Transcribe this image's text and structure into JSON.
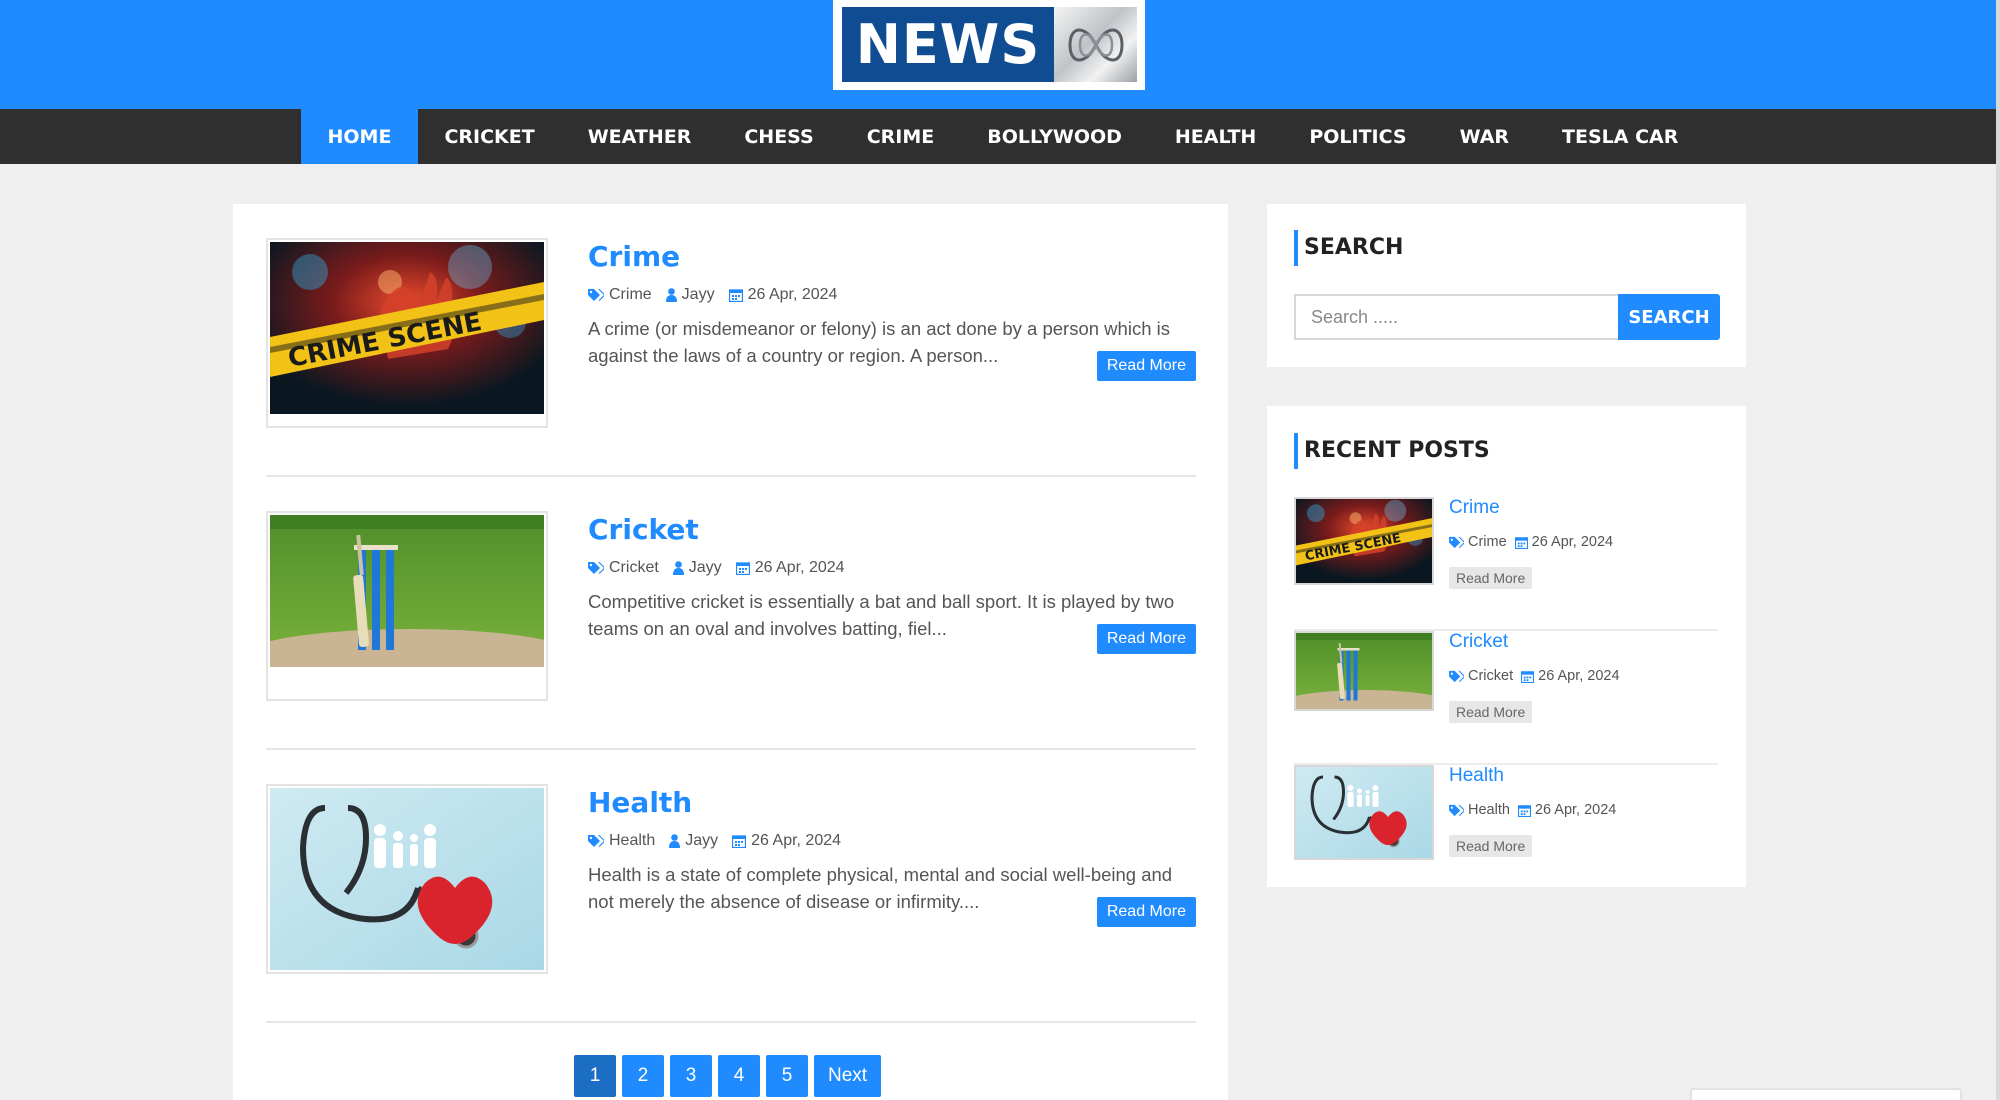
{
  "logo": {
    "text": "NEWS",
    "mark_icon": "abc-lissajous-icon"
  },
  "nav": {
    "items": [
      {
        "label": "HOME",
        "active": true
      },
      {
        "label": "CRICKET"
      },
      {
        "label": "WEATHER"
      },
      {
        "label": "CHESS"
      },
      {
        "label": "CRIME"
      },
      {
        "label": "BOLLYWOOD"
      },
      {
        "label": "HEALTH"
      },
      {
        "label": "POLITICS"
      },
      {
        "label": "WAR"
      },
      {
        "label": "TESLA CAR"
      }
    ]
  },
  "posts": [
    {
      "title": "Crime",
      "category": "Crime",
      "author": "Jayy",
      "date": "26 Apr, 2024",
      "excerpt": "A crime (or misdemeanor or felony) is an act done by a person which is against the laws of a country or region. A person...",
      "read_more": "Read More",
      "image": "crime-scene-tape-photo"
    },
    {
      "title": "Cricket",
      "category": "Cricket",
      "author": "Jayy",
      "date": "26 Apr, 2024",
      "excerpt": "Competitive cricket is essentially a bat and ball sport. It is played by two teams on an oval and involves batting, fiel...",
      "read_more": "Read More",
      "image": "cricket-wickets-photo"
    },
    {
      "title": "Health",
      "category": "Health",
      "author": "Jayy",
      "date": "26 Apr, 2024",
      "excerpt": "Health is a state of complete physical, mental and social well-being and not merely the absence of disease or infirmity....",
      "read_more": "Read More",
      "image": "stethoscope-heart-photo"
    }
  ],
  "pagination": {
    "pages": [
      "1",
      "2",
      "3",
      "4",
      "5"
    ],
    "current": "1",
    "next_label": "Next"
  },
  "sidebar": {
    "search": {
      "title": "SEARCH",
      "placeholder": "Search .....",
      "button": "SEARCH"
    },
    "recent": {
      "title": "RECENT POSTS",
      "items": [
        {
          "title": "Crime",
          "category": "Crime",
          "date": "26 Apr, 2024",
          "read_more": "Read More"
        },
        {
          "title": "Cricket",
          "category": "Cricket",
          "date": "26 Apr, 2024",
          "read_more": "Read More"
        },
        {
          "title": "Health",
          "category": "Health",
          "date": "26 Apr, 2024",
          "read_more": "Read More"
        }
      ]
    }
  },
  "colors": {
    "accent": "#1f8bff",
    "nav_bg": "#2f2f2f",
    "logo_bg": "#104c91",
    "page_bg": "#efefef"
  }
}
